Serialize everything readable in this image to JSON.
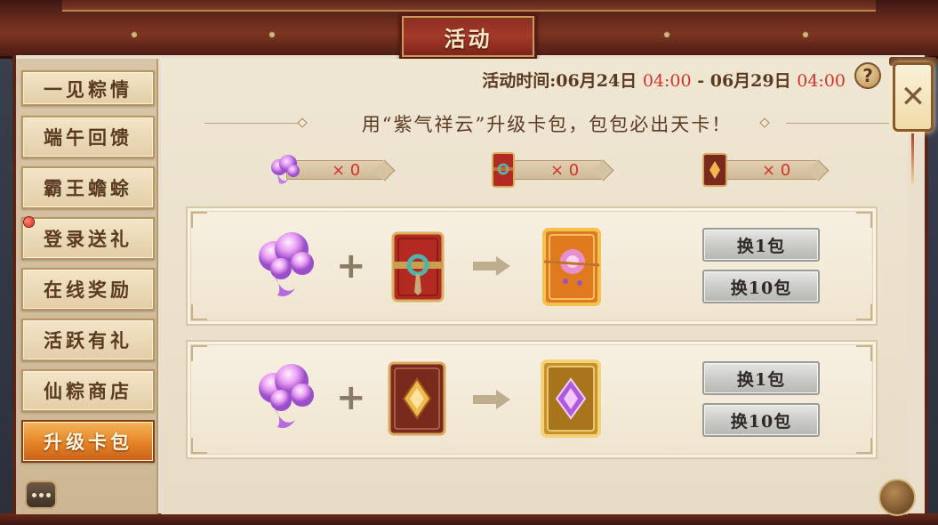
{
  "window": {
    "title": "活动"
  },
  "sidebar": {
    "items": [
      {
        "label": "一见粽情",
        "active": false
      },
      {
        "label": "端午回馈",
        "active": false
      },
      {
        "label": "霸王蟾蜍",
        "active": false
      },
      {
        "label": "登录送礼",
        "active": false,
        "badge": "red-dot"
      },
      {
        "label": "在线奖励",
        "active": false
      },
      {
        "label": "活跃有礼",
        "active": false
      },
      {
        "label": "仙粽商店",
        "active": false
      },
      {
        "label": "升级卡包",
        "active": true
      }
    ]
  },
  "event_time": {
    "prefix": "活动时间:",
    "start_date": "06月24日",
    "start_time": "04:00",
    "separator": "-",
    "end_date": "06月29日",
    "end_time": "04:00"
  },
  "help": {
    "label": "?"
  },
  "close": {
    "label": "✕"
  },
  "headline": "用“紫气祥云”升级卡包，包包必出天卡！",
  "counters": [
    {
      "item": "purple-cloud",
      "text": "× 0"
    },
    {
      "item": "red-card-pack",
      "text": "× 0"
    },
    {
      "item": "brown-card-pack",
      "text": "× 0"
    }
  ],
  "recipes": [
    {
      "input_a": "purple-cloud",
      "input_b": "red-card-pack",
      "output": "gold-orange-card-pack",
      "plus": "+",
      "buttons": [
        "换1包",
        "换10包"
      ]
    },
    {
      "input_a": "purple-cloud",
      "input_b": "brown-card-pack",
      "output": "gold-purple-card-pack",
      "plus": "+",
      "buttons": [
        "换1包",
        "换10包"
      ]
    }
  ],
  "colors": {
    "accent_red": "#d0342a",
    "frame_wood": "#6a2a1c",
    "active_tab": "#e58326",
    "panel_bg": "#efe6d3"
  }
}
